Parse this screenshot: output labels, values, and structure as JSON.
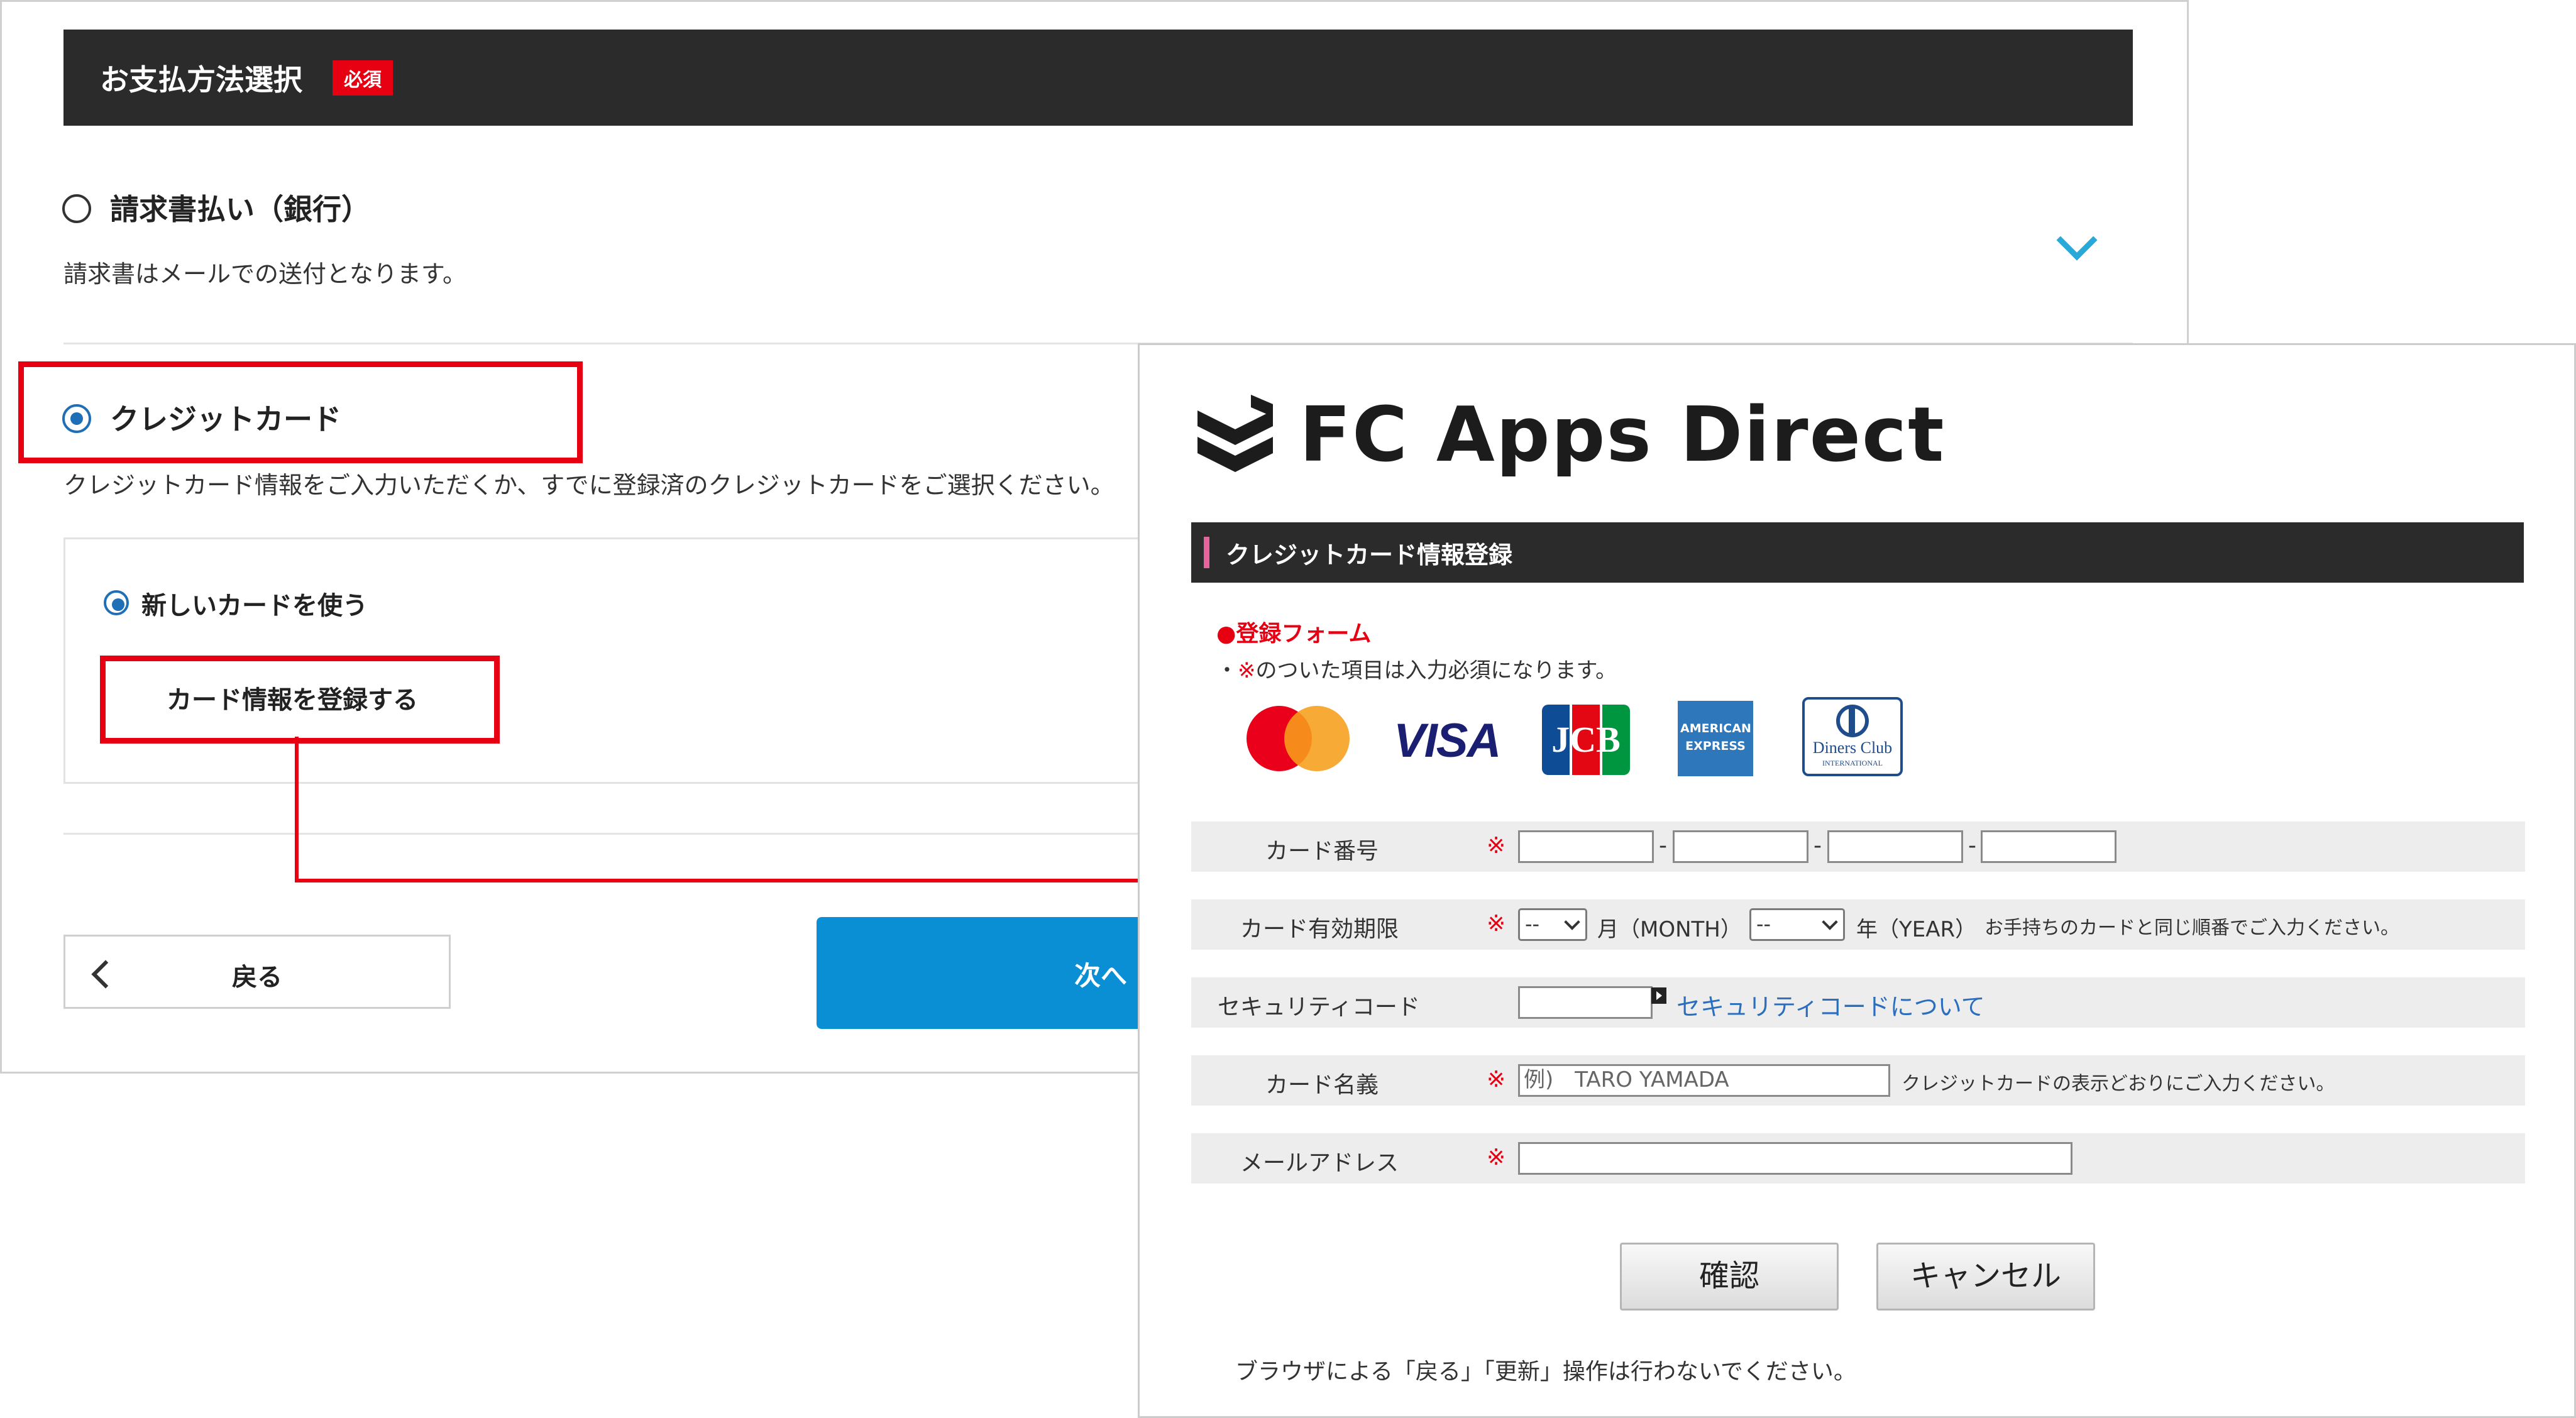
{
  "payment": {
    "title": "お支払方法選択",
    "required_badge": "必須",
    "options": [
      {
        "label": "請求書払い（銀行）",
        "description": "請求書はメールでの送付となります。",
        "selected": false
      },
      {
        "label": "クレジットカード",
        "description": "クレジットカード情報をご入力いただくか、すでに登録済のクレジットカードをご選択ください。",
        "selected": true
      }
    ],
    "new_card_label": "新しいカードを使う",
    "register_card_label": "カード情報を登録する",
    "back_label": "戻る",
    "next_label": "次へ"
  },
  "form": {
    "brand": "FC Apps Direct",
    "header": "クレジットカード情報登録",
    "section_title": "●登録フォーム",
    "note_prefix": "・",
    "note_mark": "※",
    "note_suffix": "のついた項目は入力必須になります。",
    "card_logos": [
      "mastercard",
      "visa",
      "jcb",
      "american-express",
      "diners-club"
    ],
    "logo_texts": {
      "visa": "VISA",
      "amex": "AMERICAN EXPRESS",
      "diners": "Diners Club",
      "diners_sub": "INTERNATIONAL"
    },
    "required_mark": "※",
    "card_number_label": "カード番号",
    "card_number_sep": "-",
    "expiry_label": "カード有効期限",
    "month_value": "--",
    "month_label": "月（MONTH）",
    "year_value": "--",
    "year_label": "年（YEAR）",
    "expiry_hint": "お手持ちのカードと同じ順番でご入力ください。",
    "security_label": "セキュリティコード",
    "security_link": "セキュリティコードについて",
    "holder_label": "カード名義",
    "holder_placeholder": "例)　TARO YAMADA",
    "holder_hint": "クレジットカードの表示どおりにご入力ください。",
    "email_label": "メールアドレス",
    "confirm_label": "確認",
    "cancel_label": "キャンセル",
    "footer_note": "ブラウザによる「戻る」「更新」操作は行わないでください。"
  },
  "colors": {
    "accent_red": "#e60012",
    "header_dark": "#2b2b2b",
    "next_blue": "#0a8fd4",
    "link_blue": "#2a6ebd",
    "chevron": "#29a9d8"
  }
}
